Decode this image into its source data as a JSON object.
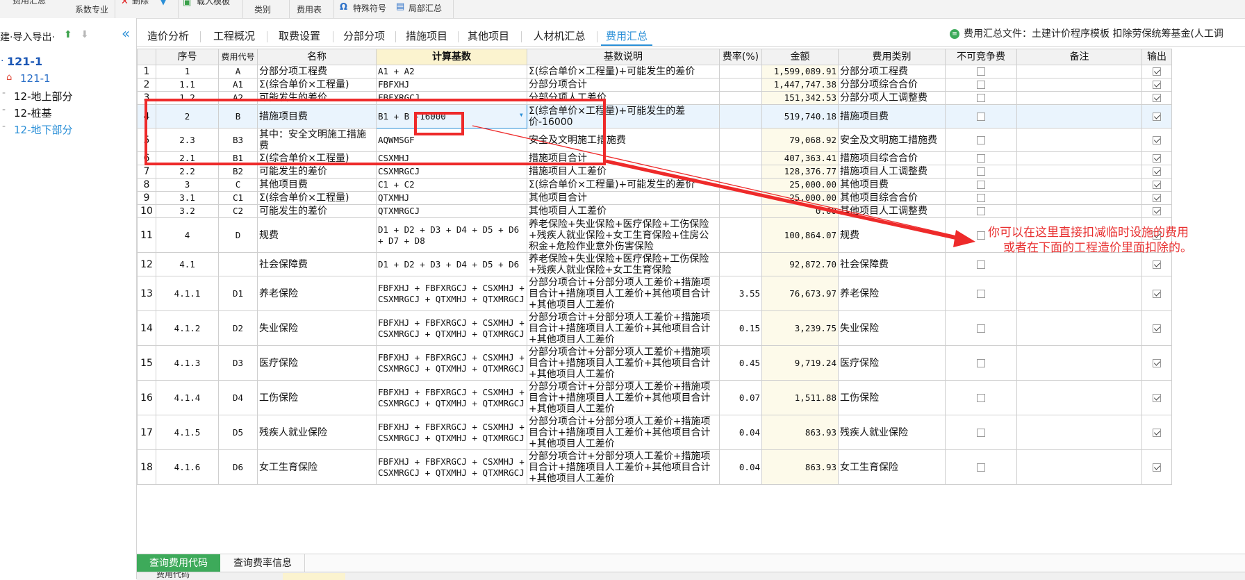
{
  "toolbar": {
    "labels": {
      "item1": "费用汇总",
      "item2": "系数专业",
      "item3": "删除",
      "item4": "载入模板",
      "item5": "类别",
      "item6": "费用表",
      "item7": "特殊符号",
      "item8": "局部汇总"
    },
    "icons": [
      "delete-x-icon",
      "chevron-down-icon",
      "load-template-icon",
      "omega-icon",
      "partial-summary-icon"
    ]
  },
  "left_panel": {
    "toolbar_label": "建·导入导出·",
    "collapse_icon": "«",
    "tree": {
      "root": "121-1",
      "child": "121-1",
      "items": [
        "12-地上部分",
        "12-桩基",
        "12-地下部分"
      ],
      "selected_index": 2
    }
  },
  "tabs": {
    "items": [
      "造价分析",
      "工程概况",
      "取费设置",
      "分部分项",
      "措施项目",
      "其他项目",
      "人材机汇总",
      "费用汇总"
    ],
    "active_index": 7,
    "summary_file_label": "费用汇总文件：土建计价程序模板 扣除劳保统筹基金(人工调"
  },
  "grid": {
    "headers": {
      "rownum": "",
      "seq": "序号",
      "code": "费用代号",
      "name": "名称",
      "calc": "计算基数",
      "desc": "基数说明",
      "rate": "费率(%)",
      "amount": "金额",
      "category": "费用类别",
      "noncompete": "不可竞争费",
      "remark": "备注",
      "output": "输出"
    },
    "rows": [
      {
        "n": "1",
        "seq": "1",
        "code": "A",
        "name": "分部分项工程费",
        "calc": "A1 + A2",
        "desc": "Σ(综合单价×工程量)+可能发生的差价",
        "rate": "",
        "amount": "1,599,089.91",
        "cat": "分部分项工程费",
        "nc": false,
        "out": true
      },
      {
        "n": "2",
        "seq": "1.1",
        "code": "A1",
        "name": "Σ(综合单价×工程量)",
        "calc": "FBFXHJ",
        "desc": "分部分项合计",
        "rate": "",
        "amount": "1,447,747.38",
        "cat": "分部分项综合合价",
        "nc": false,
        "out": true
      },
      {
        "n": "3",
        "seq": "1.2",
        "code": "A2",
        "name": "可能发生的差价",
        "calc": "FBFXRGCJ",
        "desc": "分部分项人工差价",
        "rate": "",
        "amount": "151,342.53",
        "cat": "分部分项人工调整费",
        "nc": false,
        "out": true
      },
      {
        "n": "4",
        "seq": "2",
        "code": "B",
        "name": "措施项目费",
        "calc": "B1 + B -16000",
        "desc": "Σ(综合单价×工程量)+可能发生的差价-16000",
        "rate": "",
        "amount": "519,740.18",
        "cat": "措施项目费",
        "nc": false,
        "out": true
      },
      {
        "n": "5",
        "seq": "2.3",
        "code": "B3",
        "name": "其中：安全文明施工措施费",
        "calc": "AQWMSGF",
        "desc": "安全及文明施工措施费",
        "rate": "",
        "amount": "79,068.92",
        "cat": "安全及文明施工措施费",
        "nc": false,
        "out": true
      },
      {
        "n": "6",
        "seq": "2.1",
        "code": "B1",
        "name": "Σ(综合单价×工程量)",
        "calc": "CSXMHJ",
        "desc": "措施项目合计",
        "rate": "",
        "amount": "407,363.41",
        "cat": "措施项目综合合价",
        "nc": false,
        "out": true
      },
      {
        "n": "7",
        "seq": "2.2",
        "code": "B2",
        "name": "可能发生的差价",
        "calc": "CSXMRGCJ",
        "desc": "措施项目人工差价",
        "rate": "",
        "amount": "128,376.77",
        "cat": "措施项目人工调整费",
        "nc": false,
        "out": true
      },
      {
        "n": "8",
        "seq": "3",
        "code": "C",
        "name": "其他项目费",
        "calc": "C1 + C2",
        "desc": "Σ(综合单价×工程量)+可能发生的差价",
        "rate": "",
        "amount": "25,000.00",
        "cat": "其他项目费",
        "nc": false,
        "out": true
      },
      {
        "n": "9",
        "seq": "3.1",
        "code": "C1",
        "name": "Σ(综合单价×工程量)",
        "calc": "QTXMHJ",
        "desc": "其他项目合计",
        "rate": "",
        "amount": "25,000.00",
        "cat": "其他项目综合合价",
        "nc": false,
        "out": true
      },
      {
        "n": "10",
        "seq": "3.2",
        "code": "C2",
        "name": "可能发生的差价",
        "calc": "QTXMRGCJ",
        "desc": "其他项目人工差价",
        "rate": "",
        "amount": "0.00",
        "cat": "其他项目人工调整费",
        "nc": false,
        "out": true
      },
      {
        "n": "11",
        "seq": "4",
        "code": "D",
        "name": "规费",
        "calc": "D1 + D2 + D3 + D4 + D5 + D6 + D7 + D8",
        "desc": "养老保险+失业保险+医疗保险+工伤保险+残疾人就业保险+女工生育保险+住房公积金+危险作业意外伤害保险",
        "rate": "",
        "amount": "100,864.07",
        "cat": "规费",
        "nc": false,
        "out": true
      },
      {
        "n": "12",
        "seq": "4.1",
        "code": "",
        "name": "社会保障费",
        "calc": "D1 + D2 + D3 + D4 + D5 + D6",
        "desc": "养老保险+失业保险+医疗保险+工伤保险+残疾人就业保险+女工生育保险",
        "rate": "",
        "amount": "92,872.70",
        "cat": "社会保障费",
        "nc": false,
        "out": true
      },
      {
        "n": "13",
        "seq": "4.1.1",
        "code": "D1",
        "name": "养老保险",
        "calc": "FBFXHJ + FBFXRGCJ + CSXMHJ + CSXMRGCJ + QTXMHJ + QTXMRGCJ",
        "desc": "分部分项合计+分部分项人工差价+措施项目合计+措施项目人工差价+其他项目合计+其他项目人工差价",
        "rate": "3.55",
        "amount": "76,673.97",
        "cat": "养老保险",
        "nc": false,
        "out": true
      },
      {
        "n": "14",
        "seq": "4.1.2",
        "code": "D2",
        "name": "失业保险",
        "calc": "FBFXHJ + FBFXRGCJ + CSXMHJ + CSXMRGCJ + QTXMHJ + QTXMRGCJ",
        "desc": "分部分项合计+分部分项人工差价+措施项目合计+措施项目人工差价+其他项目合计+其他项目人工差价",
        "rate": "0.15",
        "amount": "3,239.75",
        "cat": "失业保险",
        "nc": false,
        "out": true
      },
      {
        "n": "15",
        "seq": "4.1.3",
        "code": "D3",
        "name": "医疗保险",
        "calc": "FBFXHJ + FBFXRGCJ + CSXMHJ + CSXMRGCJ + QTXMHJ + QTXMRGCJ",
        "desc": "分部分项合计+分部分项人工差价+措施项目合计+措施项目人工差价+其他项目合计+其他项目人工差价",
        "rate": "0.45",
        "amount": "9,719.24",
        "cat": "医疗保险",
        "nc": false,
        "out": true
      },
      {
        "n": "16",
        "seq": "4.1.4",
        "code": "D4",
        "name": "工伤保险",
        "calc": "FBFXHJ + FBFXRGCJ + CSXMHJ + CSXMRGCJ + QTXMHJ + QTXMRGCJ",
        "desc": "分部分项合计+分部分项人工差价+措施项目合计+措施项目人工差价+其他项目合计+其他项目人工差价",
        "rate": "0.07",
        "amount": "1,511.88",
        "cat": "工伤保险",
        "nc": false,
        "out": true
      },
      {
        "n": "17",
        "seq": "4.1.5",
        "code": "D5",
        "name": "残疾人就业保险",
        "calc": "FBFXHJ + FBFXRGCJ + CSXMHJ + CSXMRGCJ + QTXMHJ + QTXMRGCJ",
        "desc": "分部分项合计+分部分项人工差价+措施项目合计+措施项目人工差价+其他项目合计+其他项目人工差价",
        "rate": "0.04",
        "amount": "863.93",
        "cat": "残疾人就业保险",
        "nc": false,
        "out": true
      },
      {
        "n": "18",
        "seq": "4.1.6",
        "code": "D6",
        "name": "女工生育保险",
        "calc": "FBFXHJ + FBFXRGCJ + CSXMHJ + CSXMRGCJ + QTXMHJ + QTXMRGCJ",
        "desc": "分部分项合计+分部分项人工差价+措施项目合计+措施项目人工差价+其他项目合计+其他项目人工差价",
        "rate": "0.04",
        "amount": "863.93",
        "cat": "女工生育保险",
        "nc": false,
        "out": true
      }
    ]
  },
  "annotation": {
    "line1": "你可以在这里直接扣减临时设施的费用",
    "line2": "或者在下面的工程造价里面扣除的。",
    "color": "#ee2a2a"
  },
  "bottom_tabs": {
    "items": [
      "查询费用代码",
      "查询费率信息"
    ],
    "active_index": 0,
    "strip_label": "费用代码"
  },
  "colors": {
    "accent": "#2a8fd7",
    "active_tab_green": "#3daa5a",
    "calc_header": "#fbf3cf",
    "annotation_red": "#ee2a2a"
  }
}
